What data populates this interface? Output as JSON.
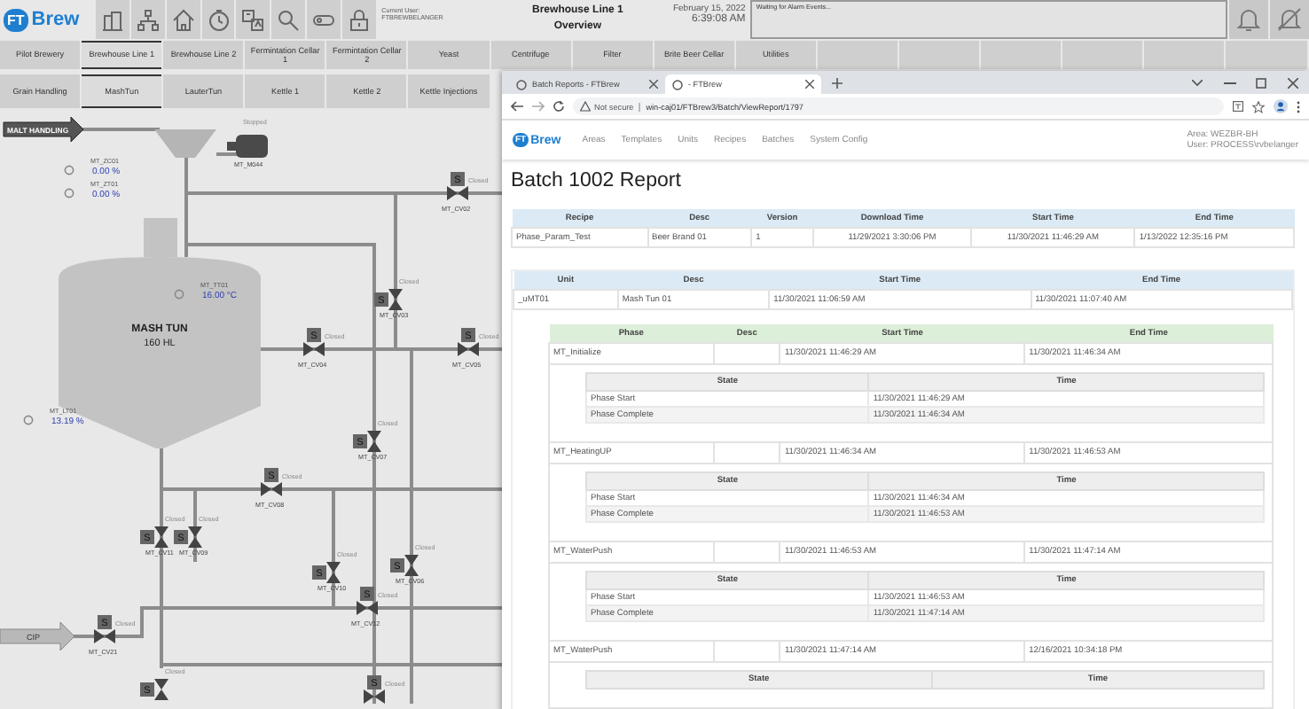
{
  "header": {
    "logo_mark": "FT",
    "logo": "Brew",
    "current_user_label": "Current User:",
    "current_user": "FTBREWBELANGER",
    "title": "Brewhouse Line 1",
    "subtitle": "Overview",
    "date": "February 15, 2022",
    "time": "6:39:08 AM",
    "alarm_message": "Waiting for Alarm Events..."
  },
  "area_tabs": [
    {
      "label": "Pilot Brewery",
      "selected": false
    },
    {
      "label": "Brewhouse Line 1",
      "selected": true
    },
    {
      "label": "Brewhouse Line 2",
      "selected": false
    },
    {
      "label": "Fermintation Cellar 1",
      "selected": false
    },
    {
      "label": "Fermintation Cellar 2",
      "selected": false
    },
    {
      "label": "Yeast",
      "selected": false
    },
    {
      "label": "Centrifuge",
      "selected": false
    },
    {
      "label": "Filter",
      "selected": false
    },
    {
      "label": "Brite Beer Cellar",
      "selected": false
    },
    {
      "label": "Utilities",
      "selected": false
    }
  ],
  "unit_tabs": [
    {
      "label": "Grain Handling",
      "selected": false
    },
    {
      "label": "MashTun",
      "selected": true
    },
    {
      "label": "LauterTun",
      "selected": false
    },
    {
      "label": "Kettle 1",
      "selected": false
    },
    {
      "label": "Kettle 2",
      "selected": false
    },
    {
      "label": "Kettle Injections",
      "selected": false
    }
  ],
  "diagram": {
    "inlet": "MALT HANDLING",
    "cip": "CIP",
    "tank": {
      "name": "MASH TUN",
      "capacity": "160 HL"
    },
    "motor": {
      "tag": "MT_M044",
      "status": "Stopped"
    },
    "readings": [
      {
        "tag": "MT_ZC01",
        "value": "0.00",
        "unit": "%"
      },
      {
        "tag": "MT_ZT01",
        "value": "0.00",
        "unit": "%"
      },
      {
        "tag": "MT_TT01",
        "value": "16.00",
        "unit": "°C"
      },
      {
        "tag": "MT_LT01",
        "value": "13.19",
        "unit": "%"
      }
    ],
    "valves": [
      {
        "tag": "MT_CV02",
        "status": "Closed",
        "actuator": "S"
      },
      {
        "tag": "MT_CV03",
        "status": "Closed",
        "actuator": "S"
      },
      {
        "tag": "MT_CV04",
        "status": "Closed",
        "actuator": "S"
      },
      {
        "tag": "MT_CV05",
        "status": "Closed",
        "actuator": "S"
      },
      {
        "tag": "MT_CV07",
        "status": "Closed",
        "actuator": "S"
      },
      {
        "tag": "MT_CV08",
        "status": "Closed",
        "actuator": "S"
      },
      {
        "tag": "MT_CV11",
        "status": "Closed",
        "actuator": "S"
      },
      {
        "tag": "MT_CV09",
        "status": "Closed",
        "actuator": "S"
      },
      {
        "tag": "MT_CV10",
        "status": "Closed",
        "actuator": "S"
      },
      {
        "tag": "MT_CV06",
        "status": "Closed",
        "actuator": "S"
      },
      {
        "tag": "MT_CV12",
        "status": "Closed",
        "actuator": "S"
      },
      {
        "tag": "MT_CV21",
        "status": "Closed",
        "actuator": "S"
      },
      {
        "status": "Closed",
        "actuator": "S"
      },
      {
        "status": "Closed",
        "actuator": "S"
      }
    ]
  },
  "browser": {
    "tabs": [
      {
        "title": "Batch Reports - FTBrew",
        "selected": false
      },
      {
        "title": "- FTBrew",
        "selected": true
      }
    ],
    "security": "Not secure",
    "url": "win-caj01/FTBrew3/Batch/ViewReport/1797",
    "app": {
      "logo_mark": "FT",
      "logo": "Brew",
      "nav": [
        "Areas",
        "Templates",
        "Units",
        "Recipes",
        "Batches",
        "System Config"
      ],
      "area": "Area: WEZBR-BH",
      "user": "User: PROCESS\\rvbelanger"
    },
    "report": {
      "title": "Batch 1002 Report",
      "recipe_columns": [
        "Recipe",
        "Desc",
        "Version",
        "Download Time",
        "Start Time",
        "End Time"
      ],
      "recipe_rows": [
        [
          "Phase_Param_Test",
          "Beer Brand 01",
          "1",
          "11/29/2021 3:30:06 PM",
          "11/30/2021 11:46:29 AM",
          "1/13/2022 12:35:16 PM"
        ]
      ],
      "unit_columns": [
        "Unit",
        "Desc",
        "Start Time",
        "End Time"
      ],
      "unit_rows": [
        [
          "_uMT01",
          "Mash Tun 01",
          "11/30/2021 11:06:59 AM",
          "11/30/2021 11:07:40 AM"
        ]
      ],
      "phase_columns": [
        "Phase",
        "Desc",
        "Start Time",
        "End Time"
      ],
      "phases": [
        {
          "name": "MT_Initialize",
          "start": "11/30/2021 11:46:29 AM",
          "end": "11/30/2021 11:46:34 AM",
          "state_columns": [
            "State",
            "Time"
          ],
          "states": [
            [
              "Phase Start",
              "11/30/2021 11:46:29 AM"
            ],
            [
              "Phase Complete",
              "11/30/2021 11:46:34 AM"
            ]
          ]
        },
        {
          "name": "MT_HeatingUP",
          "start": "11/30/2021 11:46:34 AM",
          "end": "11/30/2021 11:46:53 AM",
          "state_columns": [
            "State",
            "Time"
          ],
          "states": [
            [
              "Phase Start",
              "11/30/2021 11:46:34 AM"
            ],
            [
              "Phase Complete",
              "11/30/2021 11:46:53 AM"
            ]
          ]
        },
        {
          "name": "MT_WaterPush",
          "start": "11/30/2021 11:46:53 AM",
          "end": "11/30/2021 11:47:14 AM",
          "state_columns": [
            "State",
            "Time"
          ],
          "states": [
            [
              "Phase Start",
              "11/30/2021 11:46:53 AM"
            ],
            [
              "Phase Complete",
              "11/30/2021 11:47:14 AM"
            ]
          ]
        },
        {
          "name": "MT_WaterPush",
          "start": "11/30/2021 11:47:14 AM",
          "end": "12/16/2021 10:34:18 PM",
          "state_columns": [
            "State",
            "Time"
          ]
        }
      ]
    }
  }
}
